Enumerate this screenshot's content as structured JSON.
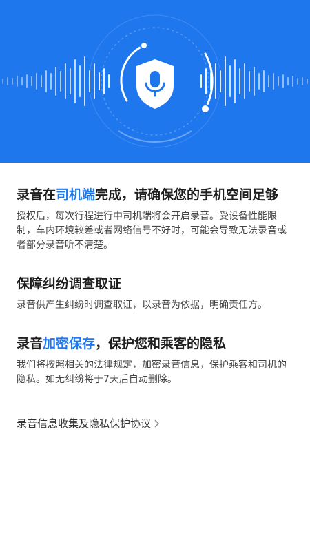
{
  "hero": {
    "bg_color": "#1f77ee",
    "icon": "microphone-shield-icon"
  },
  "sections": [
    {
      "title_pre": "录音在",
      "title_hl": "司机端",
      "title_post": "完成，请确保您的手机空间足够",
      "body": "授权后，每次行程进行中司机端将会开启录音。受设备性能限制，车内环境较差或者网络信号不好时，可能会导致无法录音或者部分录音听不清楚。"
    },
    {
      "title": "保障纠纷调查取证",
      "body": "录音供产生纠纷时调查取证，以录音为依据，明确责任方。"
    },
    {
      "title_pre": "录音",
      "title_hl": "加密保存",
      "title_post": "，保护您和乘客的隐私",
      "body": "我们将按照相关的法律规定，加密录音信息，保护乘客和司机的隐私。如无纠纷将于7天后自动删除。"
    }
  ],
  "agreement": {
    "label": "录音信息收集及隐私保护协议",
    "icon": "chevron-right-icon"
  },
  "accent_color": "#1f77ee"
}
